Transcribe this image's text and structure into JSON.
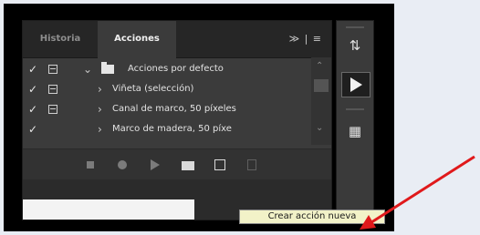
{
  "tabs": [
    {
      "label": "Historia"
    },
    {
      "label": "Acciones"
    }
  ],
  "tab_menu_glyph": "≫ | ≡",
  "action_rows": [
    {
      "label": "Acciones por defecto",
      "expanded": true
    },
    {
      "label": "Viñeta (selección)"
    },
    {
      "label": "Canal de marco, 50 píxeles"
    },
    {
      "label": "Marco de madera, 50 píxe"
    }
  ],
  "tooltip": "Crear acción nueva",
  "colors": {
    "panel_bg": "#3b3b3b",
    "tab_bar": "#262626",
    "tooltip_bg": "#f2f2c8",
    "arrow": "#e0191b"
  },
  "icons": {
    "toolbar": [
      "stop-icon",
      "record-icon",
      "play-icon",
      "folder-icon",
      "new-action-icon",
      "trash-icon"
    ],
    "side": [
      "history-icon",
      "actions-play-icon",
      "properties-icon"
    ]
  }
}
